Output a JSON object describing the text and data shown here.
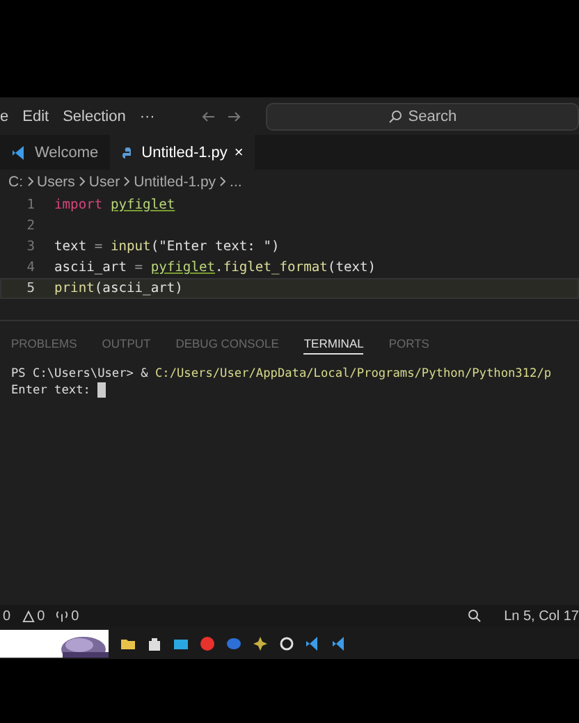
{
  "menu_bar": {
    "items": [
      "e",
      "Edit",
      "Selection",
      "···"
    ],
    "search": {
      "placeholder": "Search"
    }
  },
  "tabs": [
    {
      "label": "Welcome",
      "kind": "welcome",
      "selected": false
    },
    {
      "label": "Untitled-1.py",
      "kind": "python",
      "selected": true,
      "close": "×"
    }
  ],
  "breadcrumb": [
    "C:",
    "Users",
    "User",
    "Untitled-1.py",
    "..."
  ],
  "editor": {
    "lines": [
      {
        "number": "1",
        "current": false,
        "tokens": [
          {
            "text": "import ",
            "kind": "keyword"
          },
          {
            "text": "pyfiglet",
            "kind": "module"
          }
        ]
      },
      {
        "number": "2",
        "current": false
      },
      {
        "number": "3",
        "current": false,
        "tokens": [
          {
            "text": "text ",
            "kind": "plain"
          },
          {
            "text": "= ",
            "kind": "op"
          },
          {
            "text": "input",
            "kind": "func"
          },
          {
            "text": "(\"Enter text: \")",
            "kind": "plain"
          }
        ]
      },
      {
        "number": "4",
        "current": false,
        "tokens": [
          {
            "text": "ascii_art ",
            "kind": "plain"
          },
          {
            "text": "= ",
            "kind": "op"
          },
          {
            "text": "pyfiglet",
            "kind": "module"
          },
          {
            "text": ".",
            "kind": "plain"
          },
          {
            "text": "figlet_format",
            "kind": "func"
          },
          {
            "text": "(text)",
            "kind": "plain"
          }
        ]
      },
      {
        "number": "5",
        "current": true,
        "tokens": [
          {
            "text": "print",
            "kind": "func"
          },
          {
            "text": "(ascii_art)",
            "kind": "plain"
          }
        ]
      }
    ]
  },
  "panel": {
    "tabs": [
      {
        "label": "PROBLEMS",
        "selected": false
      },
      {
        "label": "OUTPUT",
        "selected": false
      },
      {
        "label": "DEBUG CONSOLE",
        "selected": false
      },
      {
        "label": "TERMINAL",
        "selected": true
      },
      {
        "label": "PORTS",
        "selected": false
      }
    ],
    "terminal": [
      {
        "prompt": "PS C:\\Users\\User> & ",
        "path": "C:/Users/User/AppData/Local/Programs/Python/Python312/p"
      },
      {
        "prompt": "Enter text: ",
        "cursor": true
      }
    ]
  },
  "status_bar": {
    "errors": "0",
    "warnings": "0",
    "ports": "0",
    "position": "Ln 5, Col 17"
  },
  "taskbar": {
    "apps": [
      {
        "kind": "folder",
        "color": "#e8c14a"
      },
      {
        "kind": "store",
        "color": "#dddddd"
      },
      {
        "kind": "mail",
        "color": "#2aa6e0"
      },
      {
        "kind": "yandex",
        "color": "#e8322b"
      },
      {
        "kind": "chat",
        "color": "#2d6fd6"
      },
      {
        "kind": "terminal",
        "color": "#c8b040"
      },
      {
        "kind": "recorder",
        "color": "#e0e0e0"
      },
      {
        "kind": "vscode",
        "color": "#3c9be8"
      },
      {
        "kind": "vscode",
        "color": "#3c9be8"
      }
    ]
  }
}
